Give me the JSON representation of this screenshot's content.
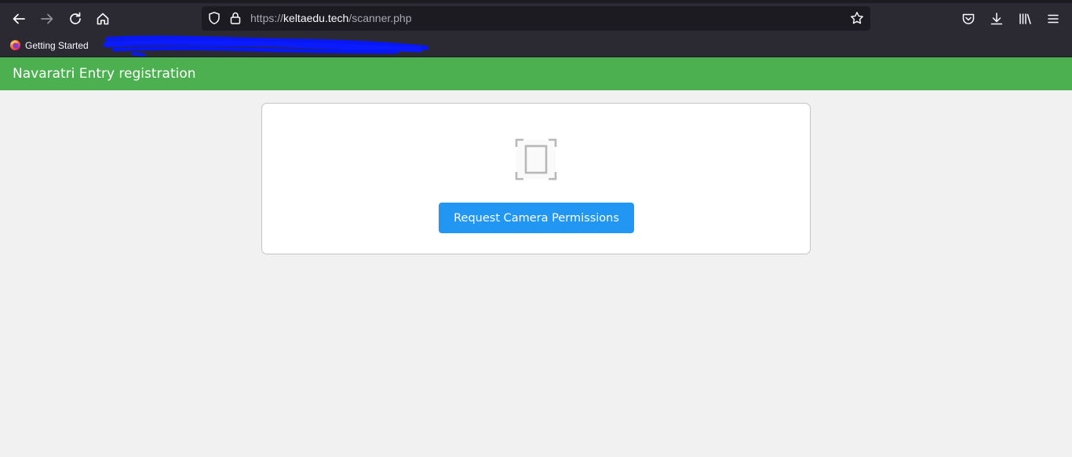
{
  "browser": {
    "url_prefix": "https://",
    "url_host": "keltaedu.tech",
    "url_path": "/scanner.php",
    "bookmarks": [
      {
        "label": "Getting Started",
        "icon": "firefox-icon"
      }
    ]
  },
  "app": {
    "title": "Navaratri Entry registration",
    "accent_color": "#4caf50"
  },
  "scanner": {
    "icon": "qr-scan-frame-icon",
    "button_label": "Request Camera Permissions",
    "button_color": "#2196f3"
  }
}
